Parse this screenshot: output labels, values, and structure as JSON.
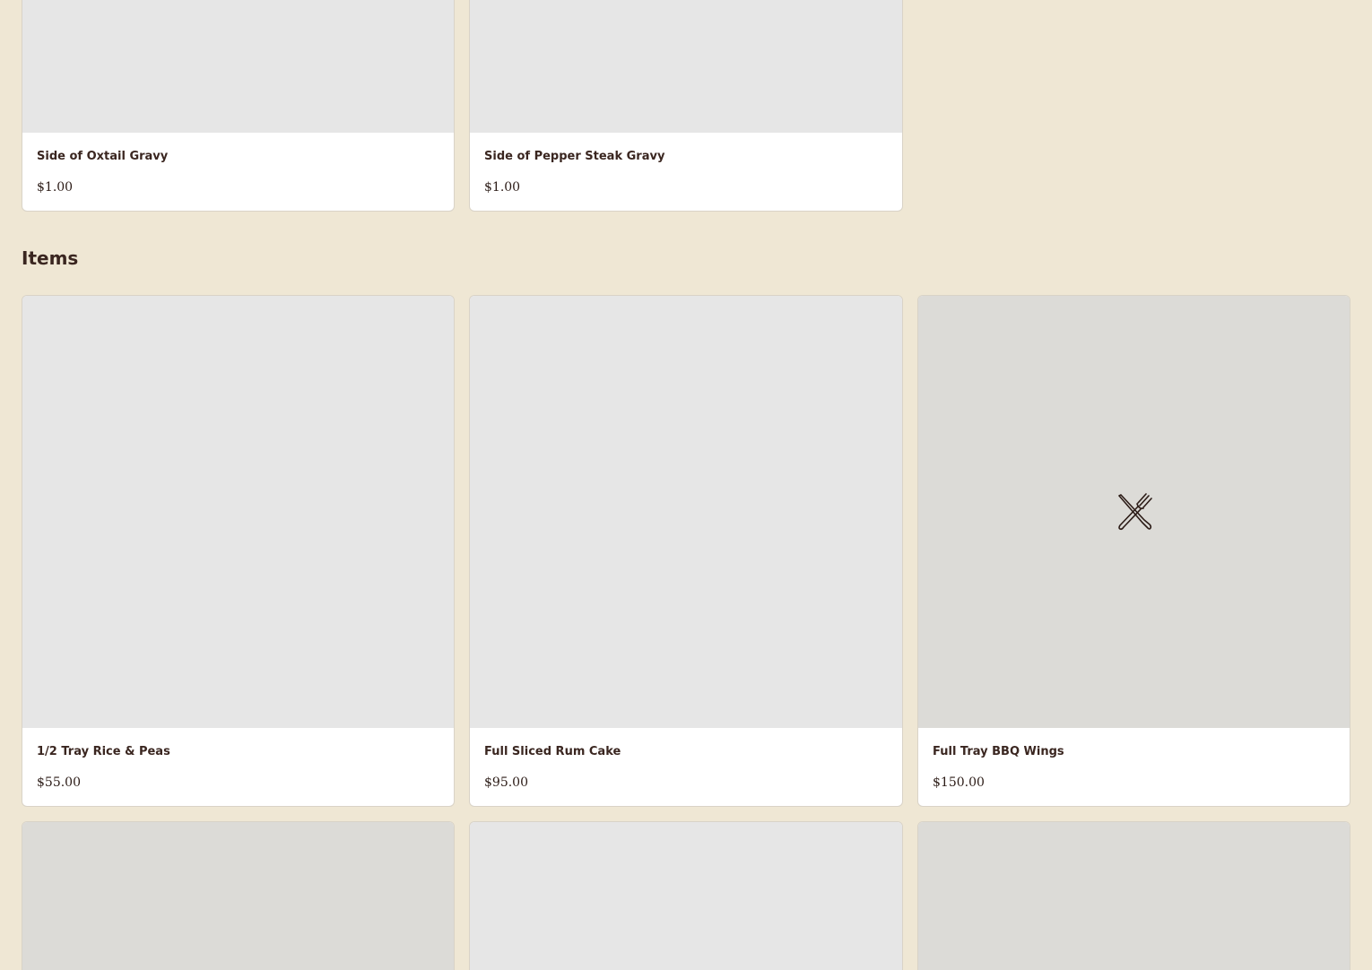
{
  "top_items": [
    {
      "name": "Side of Oxtail Gravy",
      "price": "$1.00"
    },
    {
      "name": "Side of Pepper Steak Gravy",
      "price": "$1.00"
    }
  ],
  "section": {
    "title": "Items"
  },
  "items": [
    {
      "name": "1/2 Tray Rice & Peas",
      "price": "$55.00"
    },
    {
      "name": "Full Sliced Rum Cake",
      "price": "$95.00"
    },
    {
      "name": "Full Tray BBQ Wings",
      "price": "$150.00",
      "placeholder_icon": "fork-knife-icon"
    }
  ],
  "colors": {
    "page_background": "#efe7d4",
    "card_background": "#ffffff",
    "image_placeholder": "#e6e6e6",
    "image_placeholder_alt": "#dcdbd7",
    "title_text": "#3a2620"
  }
}
